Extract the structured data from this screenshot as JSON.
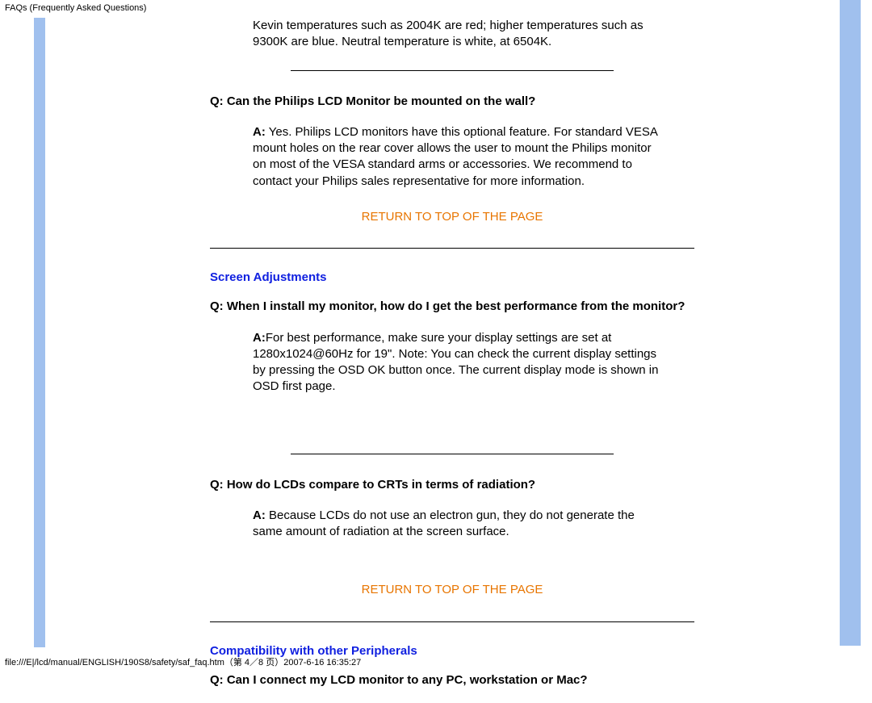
{
  "header": {
    "title": "FAQs (Frequently Asked Questions)"
  },
  "intro": {
    "text": "Kevin temperatures such as 2004K are red; higher temperatures such as 9300K are blue. Neutral temperature is white, at 6504K."
  },
  "faq1": {
    "q_prefix": "Q: ",
    "q_text": "Can the Philips LCD Monitor be mounted on the wall?",
    "a_prefix": "A:",
    "a_text": " Yes. Philips LCD monitors have this optional feature. For standard VESA mount holes on the rear cover allows the user to mount the Philips monitor on most of the VESA standard arms or accessories. We recommend to contact your Philips sales representative for more information."
  },
  "return_link": "RETURN TO TOP OF THE PAGE",
  "section1": {
    "title": "Screen Adjustments",
    "q1": {
      "q_prefix": "Q: ",
      "q_text": "When I install my monitor, how do I get the best performance from the monitor?",
      "a_prefix": "A:",
      "a_text": "For best performance, make sure your display settings are set at 1280x1024@60Hz for 19\". Note: You can check the current display settings by pressing the OSD OK button once. The current display mode is shown in OSD first page."
    },
    "q2": {
      "q_prefix": "Q: ",
      "q_text": "How do LCDs compare to CRTs in terms of radiation?",
      "a_prefix": "A: ",
      "a_text": "Because LCDs do not use an electron gun, they do not generate the same amount of radiation at the screen surface."
    }
  },
  "section2": {
    "title": "Compatibility with other Peripherals",
    "q1": {
      "q_prefix": "Q: ",
      "q_text": "Can I connect my LCD monitor to any PC, workstation or Mac?"
    }
  },
  "footer": {
    "text": "file:///E|/lcd/manual/ENGLISH/190S8/safety/saf_faq.htm（第 4／8 页）2007-6-16 16:35:27"
  }
}
